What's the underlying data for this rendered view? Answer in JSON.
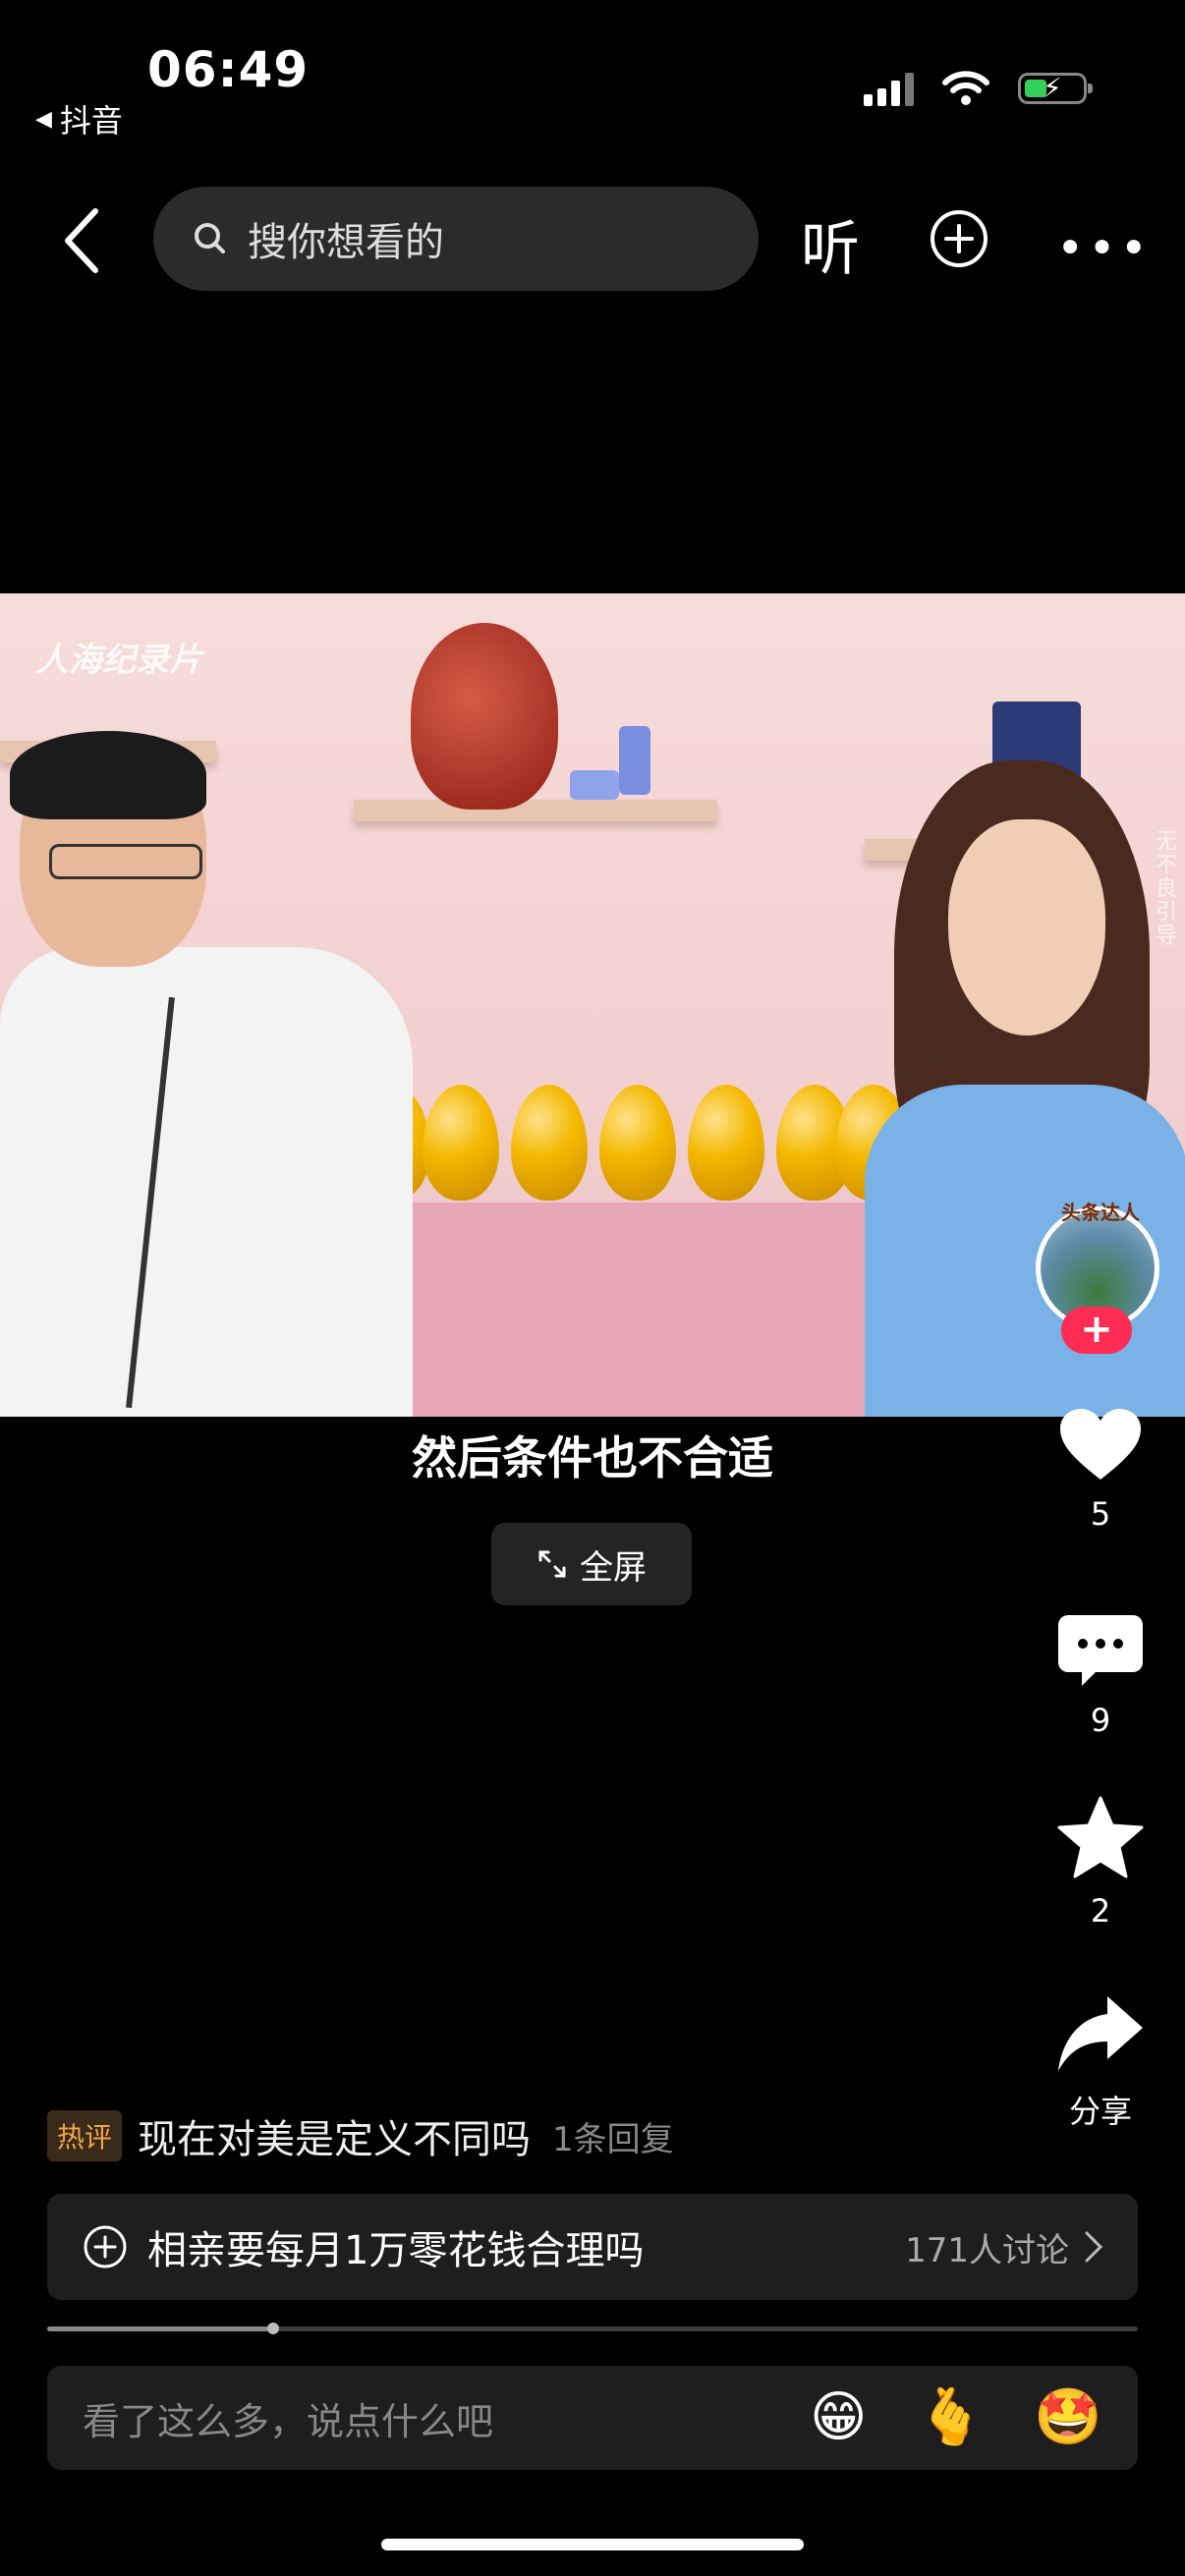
{
  "status_bar": {
    "time": "06:49",
    "back_app_label": "抖音",
    "battery_color": "#35d05a"
  },
  "top_nav": {
    "search_placeholder": "搜你想看的",
    "listen_label": "听",
    "icons": [
      "chevron-left-icon",
      "search-icon",
      "plus-circle-icon",
      "more-icon"
    ]
  },
  "video": {
    "watermark": "人海纪录片",
    "side_watermark": "无不良引导",
    "avatar_badge": "头条达人",
    "subtitle": "然后条件也不合适",
    "fullscreen_label": "全屏"
  },
  "actions": {
    "like_count": "5",
    "comment_count": "9",
    "favorite_count": "2",
    "share_label": "分享"
  },
  "hot_comment": {
    "tag": "热评",
    "text": "现在对美是定义不同吗",
    "reply": "1条回复"
  },
  "topic": {
    "text": "相亲要每月1万零花钱合理吗",
    "meta": "171人讨论"
  },
  "progress": {
    "fraction": 0.207
  },
  "comment_input": {
    "placeholder": "看了这么多，说点什么吧",
    "emojis": [
      "😁",
      "🫰",
      "🤩"
    ]
  }
}
